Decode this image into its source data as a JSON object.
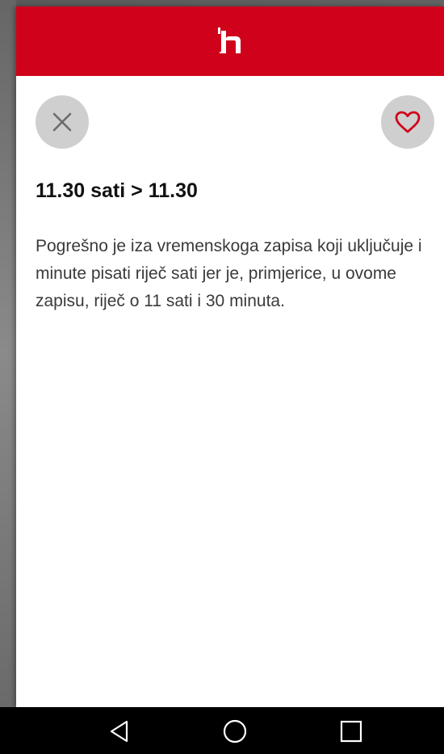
{
  "app": {
    "logo_letter": "h",
    "brand_color": "#d0021b"
  },
  "actions": {
    "close_icon": "close-icon",
    "favorite_icon": "heart-outline-icon"
  },
  "article": {
    "title": "11.30 sati > 11.30",
    "body": "Pogrešno je iza vremenskoga zapisa koji uključuje i minute pisati riječ sati jer je, primjerice, u ovome zapisu, riječ o 11 sati i 30 minuta."
  },
  "system_nav": {
    "back_icon": "back-triangle-icon",
    "home_icon": "home-circle-icon",
    "recents_icon": "recents-square-icon"
  }
}
